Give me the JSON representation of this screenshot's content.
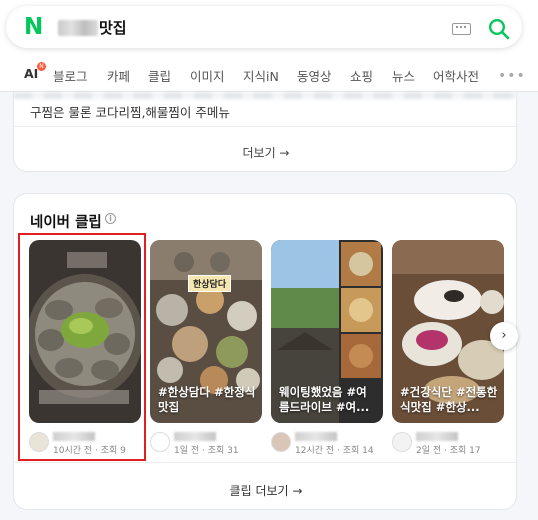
{
  "search": {
    "query_suffix": "맛집",
    "keyboard_icon": "keyboard-icon",
    "search_icon": "search-icon",
    "brand_color": "#03c75a"
  },
  "tabs": [
    {
      "label": "AI",
      "badge": "N"
    },
    {
      "label": "블로그"
    },
    {
      "label": "카페"
    },
    {
      "label": "클립"
    },
    {
      "label": "이미지"
    },
    {
      "label": "지식iN"
    },
    {
      "label": "동영상"
    },
    {
      "label": "쇼핑"
    },
    {
      "label": "뉴스"
    },
    {
      "label": "어학사전"
    }
  ],
  "place_card": {
    "menu_text": "구찜은 물론 코다리찜,해물찜이 주메뉴",
    "more_label": "더보기 →"
  },
  "clips": {
    "title": "네이버 클립",
    "info_icon": "i",
    "items": [
      {
        "caption": "",
        "meta": "10시간 전 · 조회 9"
      },
      {
        "caption": "#한상담다 #한정식맛집",
        "badge": "한상담다",
        "meta": "1일 전 · 조회 31"
      },
      {
        "caption": "웨이팅했었음 #여름드라이브 #여...",
        "meta": "12시간 전 · 조회 14"
      },
      {
        "caption": "#건강식단 #전통한식맛집 #한상...",
        "meta": "2일 전 · 조회 17"
      }
    ],
    "next_icon": "›",
    "more_label": "클립 더보기 →"
  },
  "highlight_color": "#e02020"
}
